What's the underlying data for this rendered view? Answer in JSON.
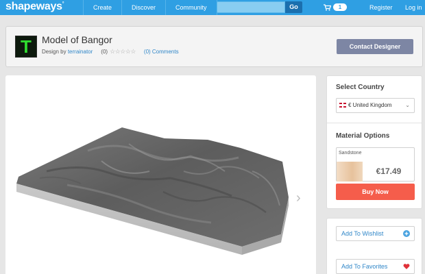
{
  "topbar": {
    "logo": "shapeways",
    "logo_mark": "°",
    "nav": [
      "Create",
      "Discover",
      "Community"
    ],
    "search_placeholder": "",
    "go_label": "Go",
    "cart_count": "1",
    "register_label": "Register",
    "login_label": "Log in",
    "color": "#2f9fe3"
  },
  "header": {
    "avatar_letter": "T",
    "title": "Model of Bangor",
    "design_by": "Design by",
    "designer": "terrainator",
    "rating_count": "(0)",
    "stars": "☆☆☆☆☆",
    "comments": "(0) Comments",
    "contact_label": "Contact Designer"
  },
  "viewer": {
    "next_glyph": "›"
  },
  "sidebar": {
    "select_country_title": "Select Country",
    "country_value": "€ United Kingdom",
    "caret": "⌄",
    "material_title": "Material Options",
    "material_name": "Sandstone",
    "price": "€17.49",
    "buy_label": "Buy Now",
    "wishlist_label": "Add To Wishlist",
    "favorites_label": "Add To Favorites",
    "buy_color": "#f55d4b"
  }
}
